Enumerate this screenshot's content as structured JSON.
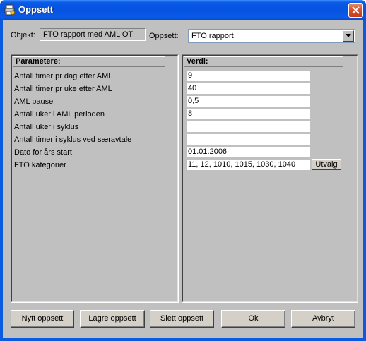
{
  "window": {
    "title": "Oppsett",
    "title_icon": "printer-settings-icon",
    "close_icon": "close-icon",
    "titlebar_color": "#0a5ae6"
  },
  "objekt": {
    "label": "Objekt:",
    "value": "FTO rapport med AML OT"
  },
  "oppsett": {
    "label": "Oppsett:",
    "selected": "FTO rapport",
    "dropdown_icon": "chevron-down-icon"
  },
  "table": {
    "param_header": "Parametere:",
    "value_header": "Verdi:",
    "rows": [
      {
        "label": "Antall timer pr dag etter AML",
        "value": "9"
      },
      {
        "label": "Antall timer pr uke etter AML",
        "value": "40"
      },
      {
        "label": "AML pause",
        "value": "0,5"
      },
      {
        "label": "Antall uker i AML perioden",
        "value": "8"
      },
      {
        "label": "Antall uker i syklus",
        "value": ""
      },
      {
        "label": "Antall timer i syklus ved særavtale",
        "value": ""
      },
      {
        "label": "Dato for års start",
        "value": "01.01.2006"
      },
      {
        "label": "FTO kategorier",
        "value": "11, 12, 1010, 1015, 1030, 1040"
      }
    ],
    "utvalg_label": "Utvalg"
  },
  "buttons": {
    "nytt": "Nytt oppsett",
    "lagre": "Lagre oppsett",
    "slett": "Slett oppsett",
    "ok": "Ok",
    "avbryt": "Avbryt"
  }
}
